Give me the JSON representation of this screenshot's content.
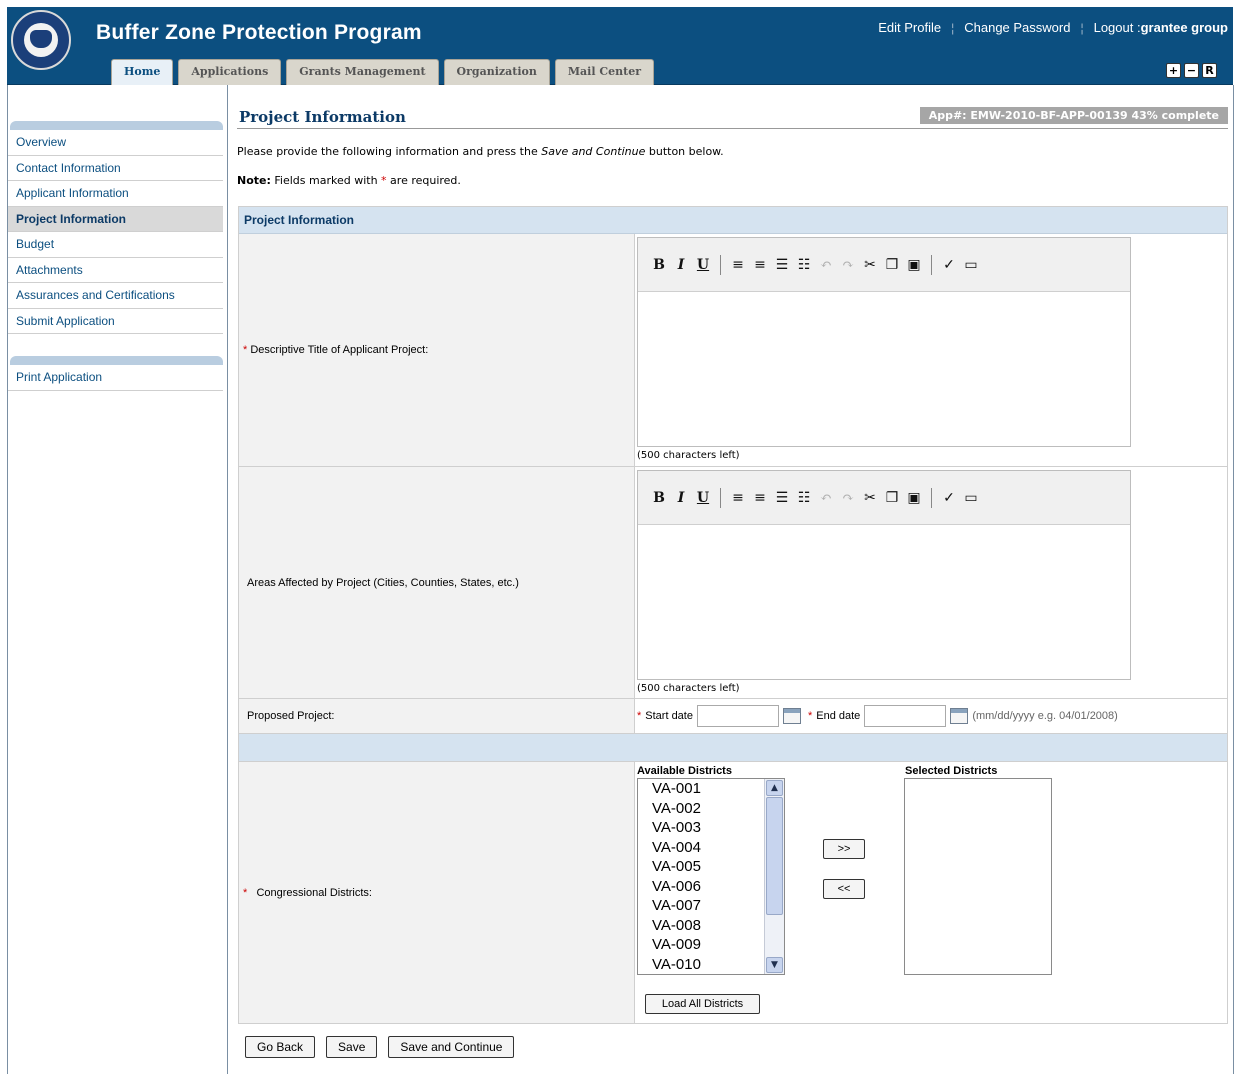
{
  "header": {
    "title": "Buffer Zone Protection Program",
    "links": {
      "edit_profile": "Edit Profile",
      "change_password": "Change Password",
      "logout": "Logout :",
      "user": "grantee group",
      "sep": "¦"
    },
    "tabs": [
      "Home",
      "Applications",
      "Grants Management",
      "Organization",
      "Mail Center"
    ],
    "active_tab": "Home",
    "zoom": {
      "plus": "+",
      "minus": "−",
      "reset": "R"
    }
  },
  "nav": {
    "items": [
      "Overview",
      "Contact Information",
      "Applicant Information",
      "Project Information",
      "Budget",
      "Attachments",
      "Assurances and Certifications",
      "Submit Application"
    ],
    "active_item": "Project Information",
    "secondary": [
      "Print Application"
    ]
  },
  "page": {
    "title": "Project Information",
    "app_badge": "App#: EMW-2010-BF-APP-00139 43% complete",
    "instructions_pre": "Please provide the following information and press the ",
    "instructions_em": "Save and Continue",
    "instructions_post": " button below.",
    "note_label": "Note:",
    "note_pre": " Fields marked with ",
    "note_star": "*",
    "note_post": " are required."
  },
  "form": {
    "section_title": "Project Information",
    "required_mark": "*",
    "title_label": "Descriptive Title of Applicant Project:",
    "title_chars_left": "(500 characters left)",
    "areas_label": "Areas Affected by Project (Cities, Counties, States, etc.)",
    "areas_chars_left": "(500 characters left)",
    "proposed_label": "Proposed Project:",
    "start_label": "Start date",
    "end_label": "End date",
    "date_hint": "(mm/dd/yyyy e.g. 04/01/2008)",
    "districts_label": "Congressional Districts:",
    "available_caption": "Available Districts",
    "selected_caption": "Selected Districts",
    "available_districts": [
      "VA-001",
      "VA-002",
      "VA-003",
      "VA-004",
      "VA-005",
      "VA-006",
      "VA-007",
      "VA-008",
      "VA-009",
      "VA-010"
    ],
    "add_button": ">>",
    "remove_button": "<<",
    "load_all_button": "Load All Districts"
  },
  "toolbar": {
    "bold": "B",
    "italic": "I",
    "underline": "U"
  },
  "footer": {
    "go_back": "Go Back",
    "save": "Save",
    "save_continue": "Save and Continue"
  },
  "colors": {
    "header_bg": "#0c4f80",
    "section_bg": "#d5e3f0",
    "required": "#cc0000",
    "link": "#0c4f80"
  }
}
